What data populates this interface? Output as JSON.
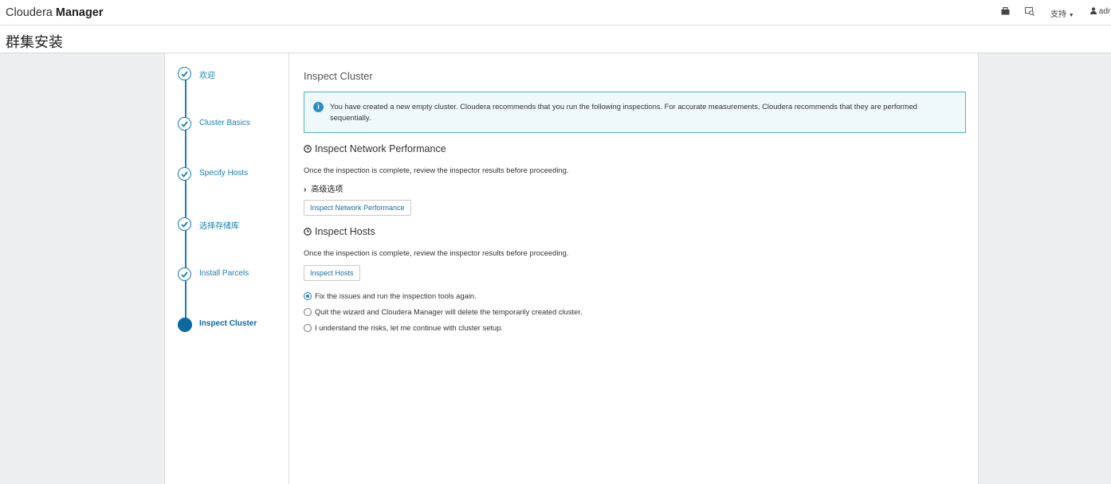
{
  "app": {
    "brand_light": "Cloudera",
    "brand_bold": "Manager"
  },
  "topnav": {
    "support_label": "支持",
    "user_label": "adr"
  },
  "page": {
    "title": "群集安装"
  },
  "steps": [
    {
      "label": "欢迎",
      "state": "done"
    },
    {
      "label": "Cluster Basics",
      "state": "done"
    },
    {
      "label": "Specify Hosts",
      "state": "done"
    },
    {
      "label": "选择存储库",
      "state": "done"
    },
    {
      "label": "Install Parcels",
      "state": "done"
    },
    {
      "label": "Inspect Cluster",
      "state": "active"
    }
  ],
  "content": {
    "title": "Inspect Cluster",
    "alert": "You have created a new empty cluster. Cloudera recommends that you run the following inspections. For accurate measurements, Cloudera recommends that they are performed sequentially.",
    "network": {
      "heading": "Inspect Network Performance",
      "desc": "Once the inspection is complete, review the inspector results before proceeding.",
      "advanced_label": "高级选项",
      "button": "Inspect Network Performance"
    },
    "hosts": {
      "heading": "Inspect Hosts",
      "desc": "Once the inspection is complete, review the inspector results before proceeding.",
      "button": "Inspect Hosts"
    },
    "options": [
      {
        "label": "Fix the issues and run the inspection tools again.",
        "selected": true
      },
      {
        "label": "Quit the wizard and Cloudera Manager will delete the temporarily created cluster.",
        "selected": false
      },
      {
        "label": "I understand the risks, let me continue with cluster setup.",
        "selected": false
      }
    ]
  },
  "colors": {
    "accent": "#1a7fb3",
    "alert_border": "#4cb3c9",
    "alert_bg": "#eff8fb"
  }
}
